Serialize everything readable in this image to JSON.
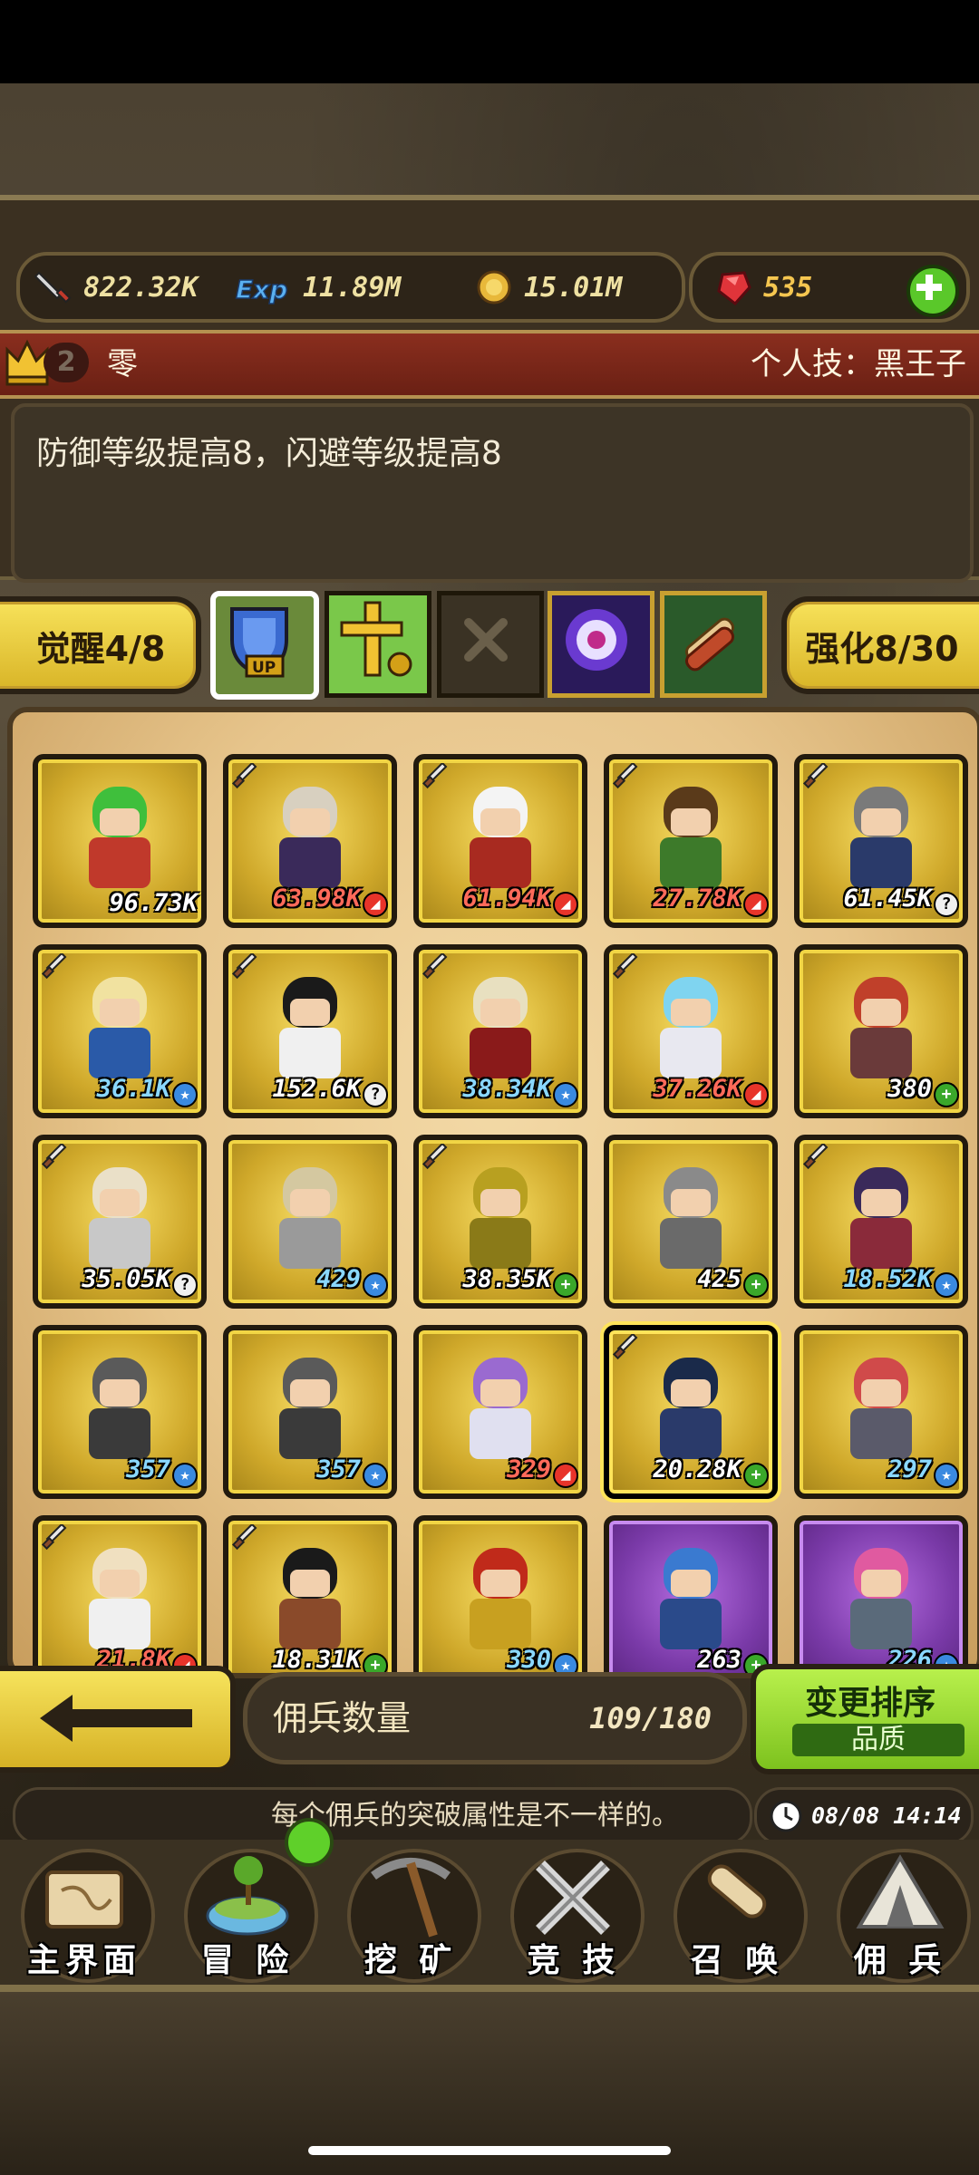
{
  "resources": {
    "attack": "822.32K",
    "exp": "11.89M",
    "gold": "15.01M",
    "gems": "535"
  },
  "hero_banner": {
    "level": "2",
    "name": "零",
    "skill": "个人技：黑王子"
  },
  "description": "防御等级提高8，闪避等级提高8",
  "awaken_label": "觉醒4/8",
  "enhance_label": "强化8/30",
  "skill_slots": [
    "defense-up",
    "cross-ally",
    "empty-slot",
    "eye-orb",
    "scroll-bundle"
  ],
  "roster": [
    {
      "power": "96.73K",
      "type": "none",
      "style": "",
      "hair": "#3fbf3c",
      "outfit": "#c0392b",
      "sword": false,
      "tier": "gold"
    },
    {
      "power": "63.98K",
      "type": "red",
      "style": "red",
      "hair": "#d8d0c0",
      "outfit": "#3a2a5a",
      "sword": true,
      "tier": "gold"
    },
    {
      "power": "61.94K",
      "type": "red",
      "style": "red",
      "hair": "#f4f4f4",
      "outfit": "#a82a20",
      "sword": true,
      "tier": "gold"
    },
    {
      "power": "27.78K",
      "type": "red",
      "style": "red",
      "hair": "#5a3a1a",
      "outfit": "#3d7a2a",
      "sword": true,
      "tier": "gold"
    },
    {
      "power": "61.45K",
      "type": "q",
      "style": "",
      "hair": "#7a7a7a",
      "outfit": "#2a3a6a",
      "sword": true,
      "tier": "gold"
    },
    {
      "power": "36.1K",
      "type": "star",
      "style": "blue",
      "hair": "#f1e2a0",
      "outfit": "#2a5aa8",
      "sword": true,
      "tier": "gold"
    },
    {
      "power": "152.6K",
      "type": "q",
      "style": "",
      "hair": "#1a1a1a",
      "outfit": "#f0f0f0",
      "sword": true,
      "tier": "gold"
    },
    {
      "power": "38.34K",
      "type": "star",
      "style": "blue",
      "hair": "#e8e0c0",
      "outfit": "#8a1a1a",
      "sword": true,
      "tier": "gold"
    },
    {
      "power": "37.26K",
      "type": "red",
      "style": "red",
      "hair": "#7fd4f0",
      "outfit": "#e8e8f0",
      "sword": true,
      "tier": "gold"
    },
    {
      "power": "380",
      "type": "plus",
      "style": "",
      "hair": "#c0402a",
      "outfit": "#6a3a3a",
      "sword": false,
      "tier": "gold"
    },
    {
      "power": "35.05K",
      "type": "q",
      "style": "",
      "hair": "#eae0c8",
      "outfit": "#c8c8c8",
      "sword": true,
      "tier": "gold"
    },
    {
      "power": "429",
      "type": "star",
      "style": "blue",
      "hair": "#d4c8a0",
      "outfit": "#9a9a9a",
      "sword": false,
      "tier": "gold"
    },
    {
      "power": "38.35K",
      "type": "plus",
      "style": "",
      "hair": "#b8a020",
      "outfit": "#8a7a18",
      "sword": true,
      "tier": "gold"
    },
    {
      "power": "425",
      "type": "plus",
      "style": "",
      "hair": "#8a8a8a",
      "outfit": "#6a6a6a",
      "sword": false,
      "tier": "gold"
    },
    {
      "power": "18.52K",
      "type": "star",
      "style": "blue",
      "hair": "#3a2a5a",
      "outfit": "#8a2a3a",
      "sword": true,
      "tier": "gold"
    },
    {
      "power": "357",
      "type": "star",
      "style": "blue",
      "hair": "#5a5a5a",
      "outfit": "#3a3a3a",
      "sword": false,
      "tier": "gold"
    },
    {
      "power": "357",
      "type": "star",
      "style": "blue",
      "hair": "#5a5a5a",
      "outfit": "#3a3a3a",
      "sword": false,
      "tier": "gold"
    },
    {
      "power": "329",
      "type": "red",
      "style": "red",
      "hair": "#9a6ad0",
      "outfit": "#e0e0f0",
      "sword": false,
      "tier": "gold"
    },
    {
      "power": "20.28K",
      "type": "plus",
      "style": "",
      "hair": "#1a2a4a",
      "outfit": "#2a3a6a",
      "sword": true,
      "tier": "gold",
      "selected": true
    },
    {
      "power": "297",
      "type": "star",
      "style": "blue",
      "hair": "#d04a4a",
      "outfit": "#5a5a6a",
      "sword": false,
      "tier": "gold"
    },
    {
      "power": "21.8K",
      "type": "red",
      "style": "red",
      "hair": "#f0e0c0",
      "outfit": "#f0f0f0",
      "sword": true,
      "tier": "gold"
    },
    {
      "power": "18.31K",
      "type": "plus",
      "style": "",
      "hair": "#1a1a1a",
      "outfit": "#8a4a2a",
      "sword": true,
      "tier": "gold"
    },
    {
      "power": "330",
      "type": "star",
      "style": "blue",
      "hair": "#c02a1a",
      "outfit": "#c8a020",
      "sword": false,
      "tier": "gold"
    },
    {
      "power": "263",
      "type": "plus",
      "style": "",
      "hair": "#3a7ad0",
      "outfit": "#2a4a8a",
      "sword": false,
      "tier": "purple"
    },
    {
      "power": "226",
      "type": "star",
      "style": "blue",
      "hair": "#e05aa0",
      "outfit": "#5a6a7a",
      "sword": false,
      "tier": "purple"
    }
  ],
  "count_label": "佣兵数量",
  "count_value": "109/180",
  "sort_title": "变更排序",
  "sort_sub": "品质",
  "message": "每个佣兵的突破属性是不一样的。",
  "clock": "08/08 14:14",
  "nav": [
    "主界面",
    "冒 险",
    "挖 矿",
    "竞 技",
    "召 唤",
    "佣 兵"
  ],
  "colors": {
    "accent": "#f5dc50",
    "banner": "#7a2418",
    "sort_green": "#9ad83a"
  }
}
